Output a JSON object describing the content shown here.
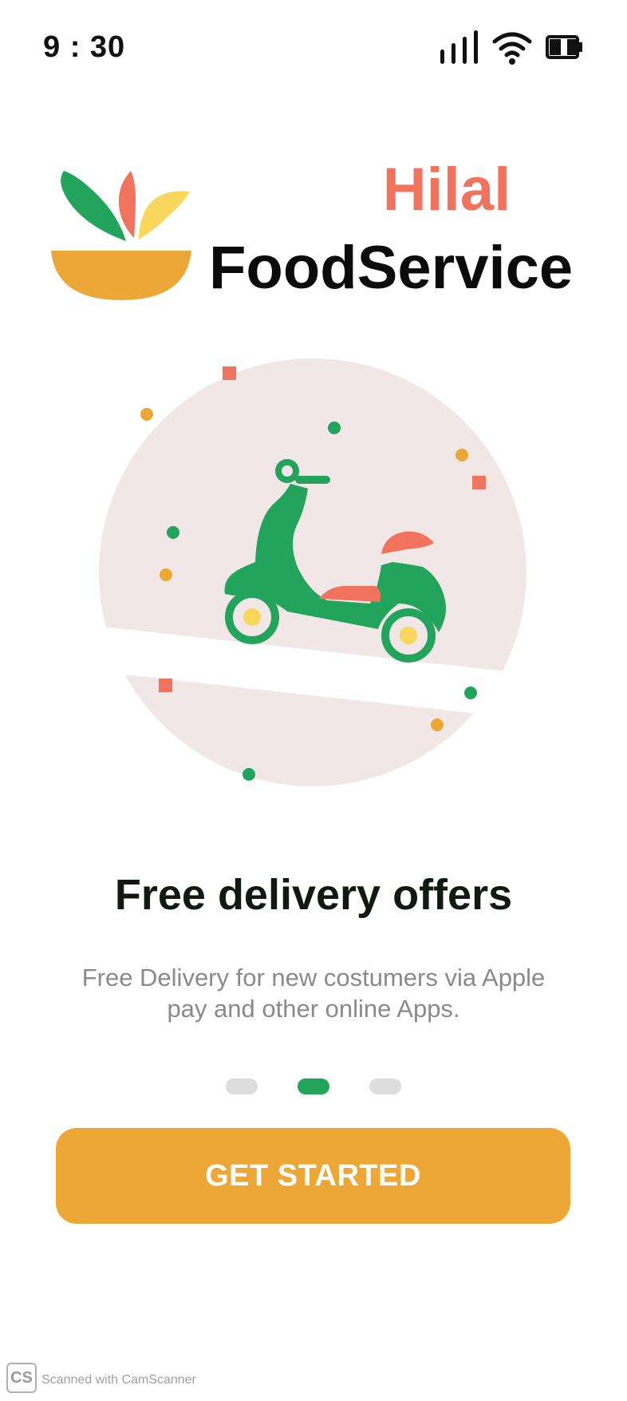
{
  "status_bar": {
    "time": "9 : 30"
  },
  "brand": {
    "name_top": "Hilal",
    "name_bottom": "FoodService"
  },
  "onboarding": {
    "title": "Free delivery offers",
    "subtitle": "Free Delivery for new costumers via Apple pay and other online Apps.",
    "pages": 3,
    "active_page": 2
  },
  "button": {
    "label": "GET STARTED"
  },
  "watermark": {
    "logo": "CS",
    "text": "Scanned with CamScanner"
  },
  "colors": {
    "accent_green": "#22A45D",
    "accent_orange": "#EDA737",
    "accent_coral": "#F1735E",
    "hero_circle": "#F1E7E7",
    "yellow": "#F9D65C"
  },
  "icons": [
    "signal-icon",
    "wifi-icon",
    "battery-icon",
    "bowl-logo-icon",
    "scooter-icon"
  ]
}
